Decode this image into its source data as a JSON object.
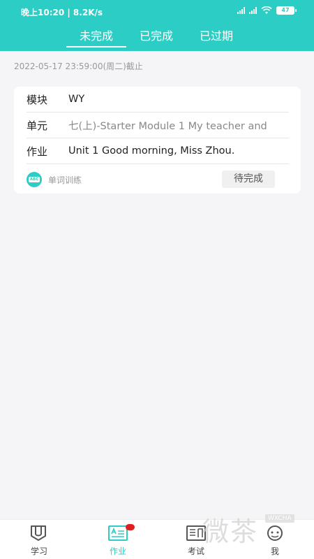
{
  "status": {
    "time": "晚上10:20 | 8.2K/s",
    "battery": "47"
  },
  "tabs": [
    {
      "label": "未完成",
      "active": true
    },
    {
      "label": "已完成",
      "active": false
    },
    {
      "label": "已过期",
      "active": false
    }
  ],
  "deadline": "2022-05-17 23:59:00(周二)截止",
  "card": {
    "module_label": "模块",
    "module_value": "WY",
    "unit_label": "单元",
    "unit_value": "七(上)-Starter Module 1  My teacher and",
    "homework_label": "作业",
    "homework_value": "Unit 1 Good morning, Miss Zhou.",
    "type_icon": "ABC",
    "type_label": "单词训练",
    "status": "待完成"
  },
  "nav": [
    {
      "label": "学习",
      "icon": "book-icon"
    },
    {
      "label": "作业",
      "icon": "homework-icon",
      "active": true
    },
    {
      "label": "考试",
      "icon": "exam-icon"
    },
    {
      "label": "我",
      "icon": "profile-icon"
    }
  ],
  "watermark": {
    "text": "微茶",
    "badge": "WXCHA"
  },
  "colors": {
    "accent": "#2ccdc4",
    "badge": "#e02020"
  }
}
